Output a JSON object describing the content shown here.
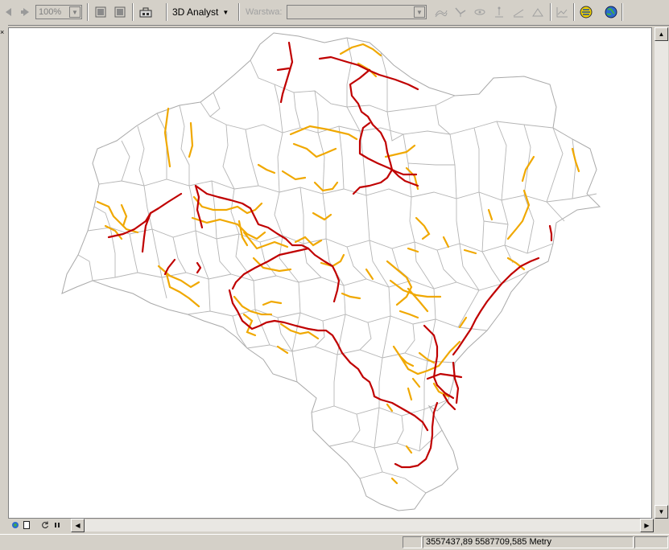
{
  "toolbar": {
    "zoom_value": "100%",
    "analyst_label": "3D Analyst",
    "layer_label": "Warstwa:",
    "layer_value": ""
  },
  "status": {
    "coordinates": "3557437,89  5587709,585 Metry"
  },
  "colors": {
    "background": "#d4d0c8",
    "boundaries": "#a9a9a9",
    "main_roads": "#c00000",
    "secondary_roads": "#f0a800"
  }
}
